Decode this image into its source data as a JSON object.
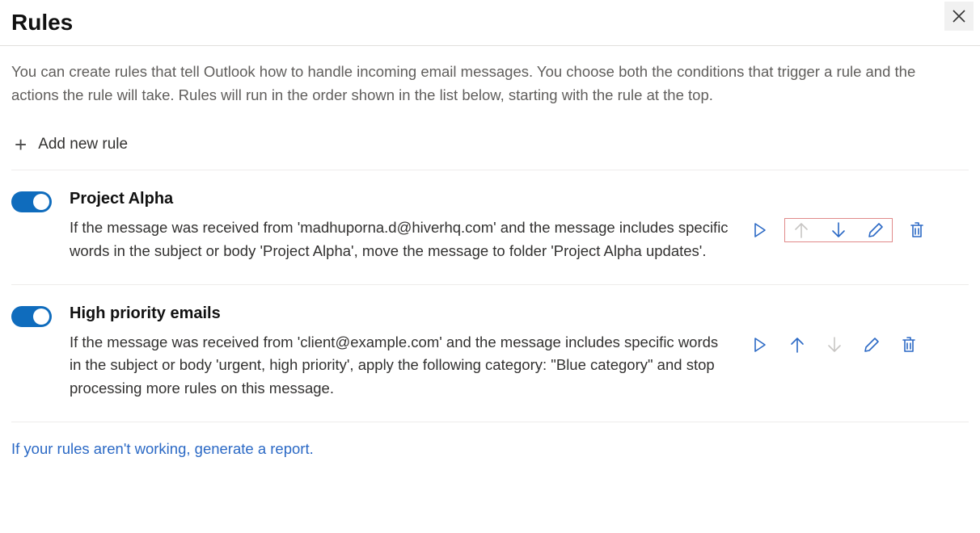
{
  "header": {
    "title": "Rules"
  },
  "intro": "You can create rules that tell Outlook how to handle incoming email messages. You choose both the conditions that trigger a rule and the actions the rule will take. Rules will run in the order shown in the list below, starting with the rule at the top.",
  "add_rule_label": "Add new rule",
  "rules": [
    {
      "name": "Project Alpha",
      "description": "If the message was received from 'madhuporna.d@hiverhq.com' and the message includes specific words in the subject or body 'Project Alpha', move the message to folder 'Project Alpha updates'.",
      "enabled": true,
      "up_disabled": true,
      "down_disabled": false,
      "highlight_group": true
    },
    {
      "name": "High priority emails",
      "description": "If the message was received from 'client@example.com' and the message includes specific words in the subject or body 'urgent, high priority', apply the following category: \"Blue category\" and stop processing more rules on this message.",
      "enabled": true,
      "up_disabled": false,
      "down_disabled": true,
      "highlight_group": false
    }
  ],
  "report_link": "If your rules aren't working, generate a report.",
  "colors": {
    "accent": "#0f6cbd",
    "icon_blue": "#2b69c5",
    "disabled": "#c8c6c4",
    "highlight_border": "#e08a8a"
  }
}
